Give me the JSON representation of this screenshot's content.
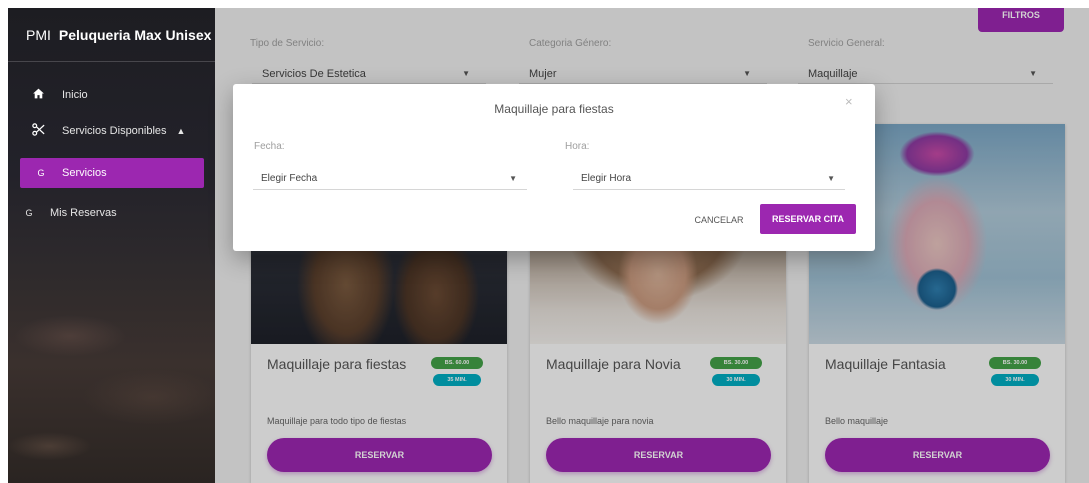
{
  "sidebar": {
    "brand_abbr": "PMI",
    "brand_name": "Peluqueria Max Unisex",
    "items": [
      {
        "label": "Inicio",
        "icon": "home-icon"
      },
      {
        "label": "Servicios Disponibles",
        "icon": "scissors-icon"
      },
      {
        "label": "Servicios",
        "letter": "G",
        "active": true
      },
      {
        "label": "Mis Reservas",
        "letter": "G"
      }
    ],
    "accent_color": "#9c27b0"
  },
  "header": {
    "filtros_label": "FILTROS"
  },
  "filters": [
    {
      "label": "Tipo de Servicio:",
      "value": "Servicios De Estetica"
    },
    {
      "label": "Categoria Género:",
      "value": "Mujer"
    },
    {
      "label": "Servicio General:",
      "value": "Maquillaje"
    }
  ],
  "cards": [
    {
      "title": "Maquillaje para fiestas",
      "price": "BS. 60.00",
      "duration": "35 MIN.",
      "description": "Maquillaje para todo tipo de fiestas",
      "button": "RESERVAR"
    },
    {
      "title": "Maquillaje para Novia",
      "price": "BS. 30.00",
      "duration": "30 MIN.",
      "description": "Bello maquillaje para novia",
      "button": "RESERVAR"
    },
    {
      "title": "Maquillaje Fantasia",
      "price": "BS. 30.00",
      "duration": "30 MIN.",
      "description": "Bello maquillaje",
      "button": "RESERVAR"
    }
  ],
  "dialog": {
    "title": "Maquillaje para fiestas",
    "close_glyph": "×",
    "fecha_label": "Fecha:",
    "fecha_placeholder": "Elegir Fecha",
    "hora_label": "Hora:",
    "hora_placeholder": "Elegir Hora",
    "cancel_label": "CANCELAR",
    "reserve_label": "RESERVAR CITA"
  }
}
